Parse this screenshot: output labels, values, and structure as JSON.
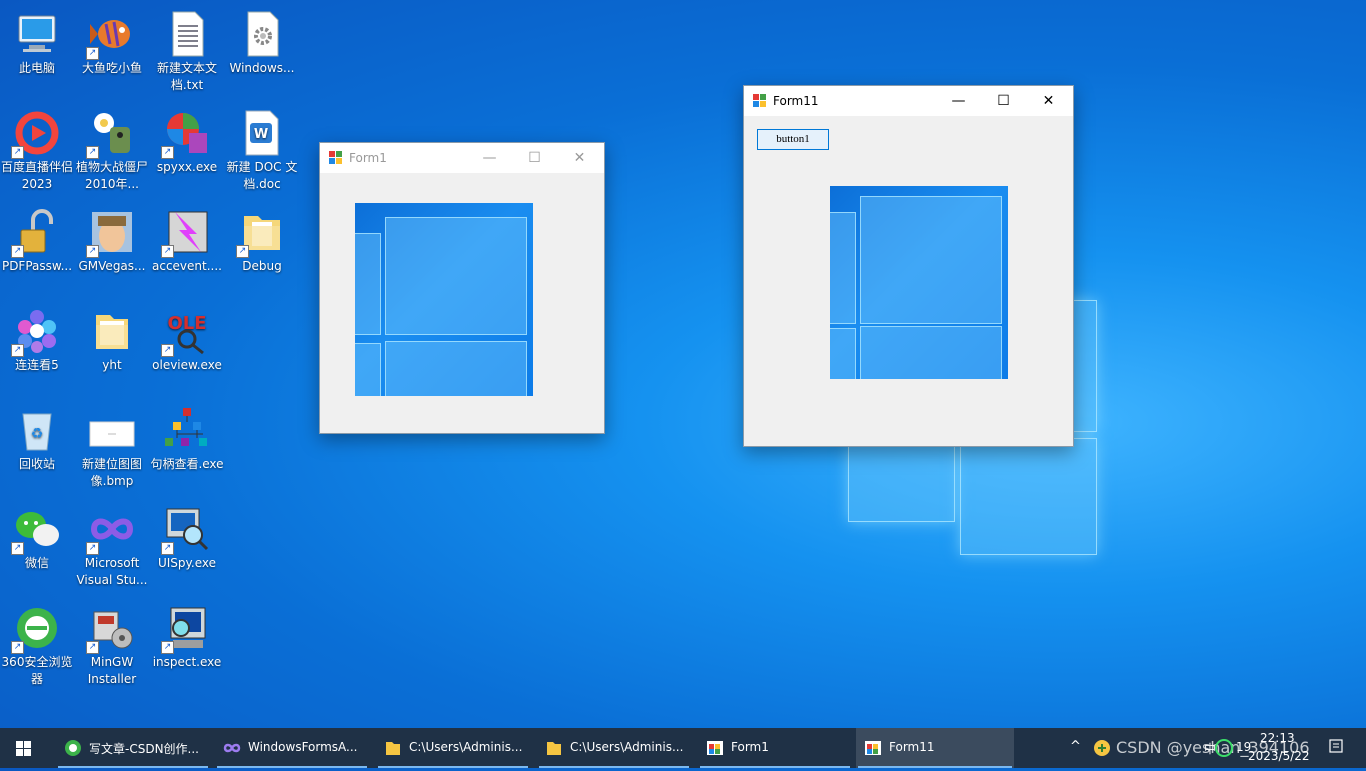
{
  "desktop": {
    "icons": [
      {
        "label": "此电脑",
        "icon": "computer-icon"
      },
      {
        "label": "大鱼吃小鱼",
        "icon": "fish-icon"
      },
      {
        "label": "新建文本文档.txt",
        "icon": "text-file-icon"
      },
      {
        "label": "Windows...",
        "icon": "gear-file-icon"
      },
      {
        "label": "百度直播伴侣2023",
        "icon": "baidu-live-icon"
      },
      {
        "label": "植物大战僵尸2010年...",
        "icon": "plants-zombies-icon"
      },
      {
        "label": "spyxx.exe",
        "icon": "spyxx-icon"
      },
      {
        "label": "新建 DOC 文档.doc",
        "icon": "word-doc-icon"
      },
      {
        "label": "PDFPassw...",
        "icon": "padlock-icon"
      },
      {
        "label": "GMVegas...",
        "icon": "gmvegas-icon"
      },
      {
        "label": "accevent....",
        "icon": "accevent-icon"
      },
      {
        "label": "Debug",
        "icon": "folder-icon"
      },
      {
        "label": "连连看5",
        "icon": "lianliankan-icon"
      },
      {
        "label": "yht",
        "icon": "folder-icon"
      },
      {
        "label": "oleview.exe",
        "icon": "oleview-icon"
      },
      {
        "label": "回收站",
        "icon": "recycle-bin-icon"
      },
      {
        "label": "新建位图图像.bmp",
        "icon": "bitmap-icon"
      },
      {
        "label": "句柄查看.exe",
        "icon": "handle-viewer-icon"
      },
      {
        "label": "微信",
        "icon": "wechat-icon"
      },
      {
        "label": "Microsoft Visual Stu...",
        "icon": "visual-studio-icon"
      },
      {
        "label": "UISpy.exe",
        "icon": "uispy-icon"
      },
      {
        "label": "360安全浏览器",
        "icon": "browser-360-icon"
      },
      {
        "label": "MinGW Installer",
        "icon": "mingw-icon"
      },
      {
        "label": "inspect.exe",
        "icon": "inspect-icon"
      }
    ]
  },
  "form1": {
    "title": "Form1",
    "minimize": "—",
    "maximize": "☐",
    "close": "✕"
  },
  "form11": {
    "title": "Form11",
    "button_label": "button1",
    "minimize": "—",
    "maximize": "☐",
    "close": "✕"
  },
  "taskbar": {
    "items": [
      {
        "label": "写文章-CSDN创作...",
        "icon": "browser-360-icon"
      },
      {
        "label": "WindowsFormsA...",
        "icon": "visual-studio-icon"
      },
      {
        "label": "C:\\Users\\Adminis...",
        "icon": "folder-icon"
      },
      {
        "label": "C:\\Users\\Adminis...",
        "icon": "folder-icon"
      },
      {
        "label": "Form1",
        "icon": "winform-icon"
      },
      {
        "label": "Form11",
        "icon": "winform-icon"
      }
    ],
    "tray": {
      "chevron": "^",
      "watermark": "CSDN @yeshan_394106",
      "ime": "中",
      "time": "22:13",
      "date": "2023/5/22",
      "notification_count": "19"
    }
  }
}
